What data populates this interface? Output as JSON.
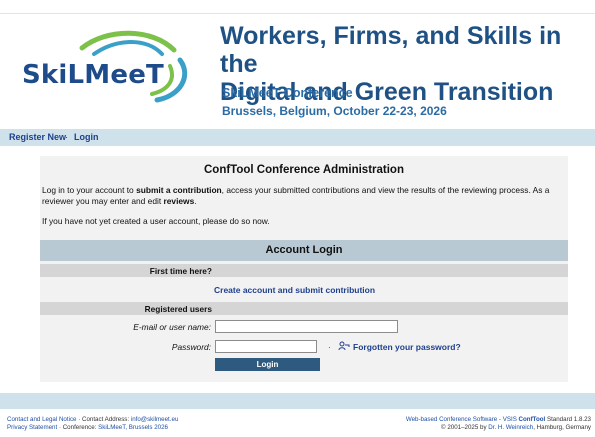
{
  "header": {
    "logo_text": "SkiLMeeT",
    "title_line1": "Workers, Firms, and Skills in the",
    "title_line2": "Digital and Green Transition",
    "conference_name": "SkiLMeeT Conference",
    "conference_place_date": "Brussels, Belgium, October 22-23, 2026"
  },
  "nav": {
    "register_label": "Register New",
    "separator": "·",
    "login_label": "Login"
  },
  "main": {
    "panel_title": "ConfTool Conference Administration",
    "intro": {
      "part1": "Log in to your account to ",
      "bold1": "submit a contribution",
      "part2": ", access your submitted contributions and view the results of the reviewing process. As a reviewer you may enter and edit ",
      "bold2": "reviews",
      "part3": "."
    },
    "intro2": "If you have not yet created a user account, please do so now."
  },
  "login": {
    "header": "Account Login",
    "first_time_label": "First time here?",
    "create_account_link": "Create account and submit contribution",
    "registered_users_label": "Registered users",
    "email_label": "E-mail or user name:",
    "email_value": "",
    "password_label": "Password:",
    "password_value": "",
    "dot": "·",
    "forgot_password_link": "Forgotten your password?",
    "login_button": "Login"
  },
  "footer": {
    "contact_link": "Contact and Legal Notice",
    "sep1": " · ",
    "contact_address_label": "Contact Address: ",
    "contact_email": "info@skilmeet.eu",
    "privacy_link": "Privacy Statement",
    "sep2": " · ",
    "conference_label": "Conference: ",
    "conference_link": "SkiLMeeT, Brussels 2026",
    "software_text": "Web-based Conference Software - VSIS ",
    "conftool_name": "ConfTool",
    "standard_version": " Standard 1.8.23",
    "copyright": "© 2001–2025 by ",
    "author_link": "Dr. H. Weinreich",
    "author_place": ", Hamburg, Germany"
  },
  "colors": {
    "title_blue": "#1f5184",
    "accent_blue": "#2a6ba4",
    "nav_bar": "#cfe2ec",
    "account_header": "#b9c9d4",
    "login_button": "#2f5a7f",
    "logo_green": "#7cc14a",
    "logo_teal": "#3aa0c8"
  },
  "icons": {
    "logo": "skilmeet-swirl-logo",
    "forgot": "key-person-icon"
  }
}
